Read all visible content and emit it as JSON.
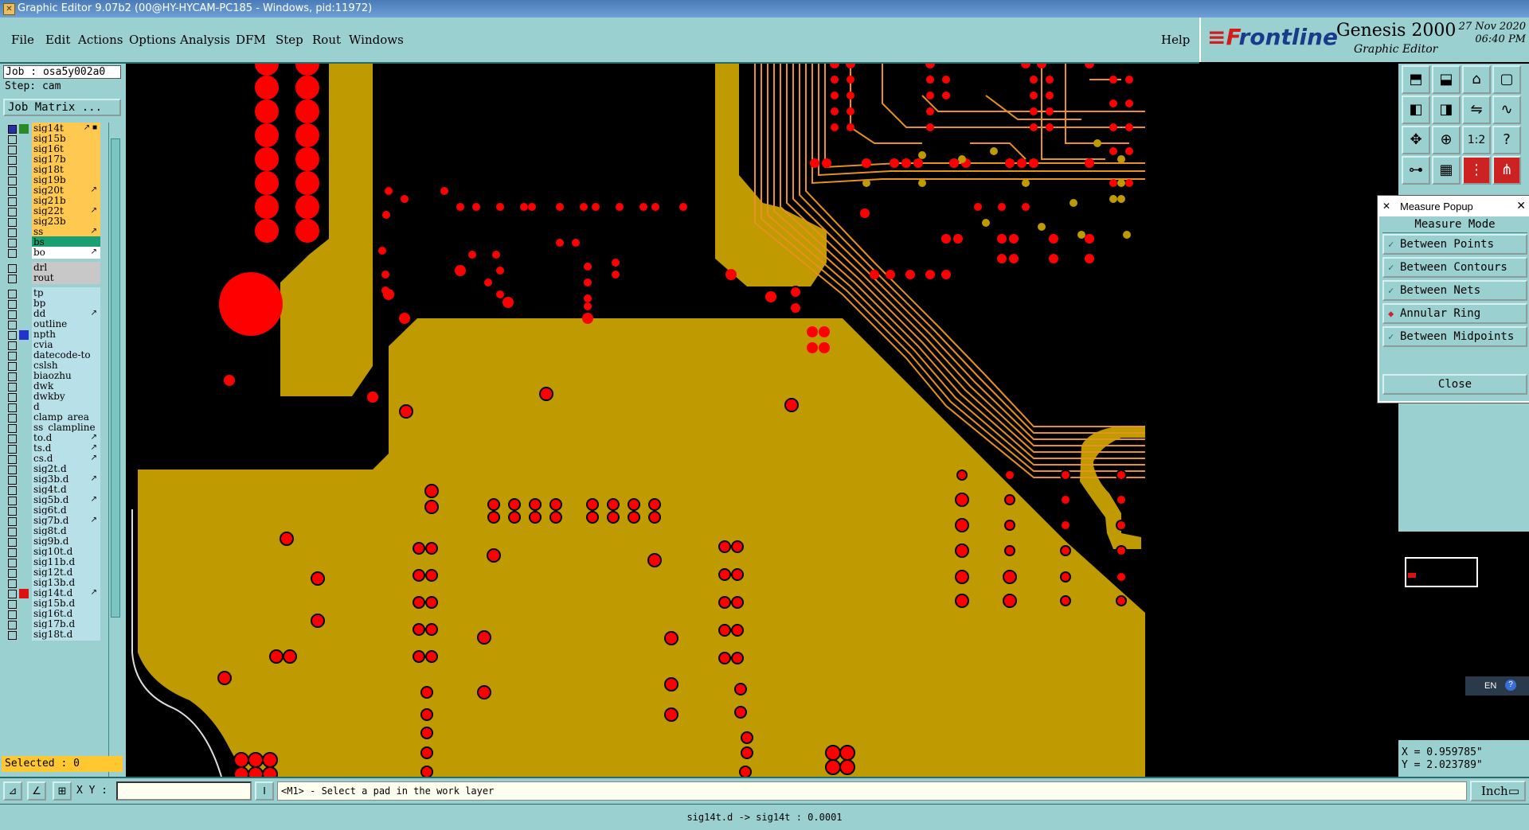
{
  "window": {
    "title": "Graphic Editor 9.07b2 (00@HY-HYCAM-PC185 - Windows, pid:11972)"
  },
  "menu": {
    "file": "File",
    "edit": "Edit",
    "actions": "Actions",
    "options": "Options",
    "analysis": "Analysis",
    "dfm": "DFM",
    "step": "Step",
    "rout": "Rout",
    "windows": "Windows",
    "help": "Help"
  },
  "brand": {
    "logo_f": "F",
    "logo_rest": "rontline",
    "product": "Genesis 2000",
    "subtitle": "Graphic Editor",
    "date": "27 Nov 2020",
    "time": "06:40 PM"
  },
  "job": {
    "job_line": "Job : osa5y002a0",
    "step_line": "Step: cam",
    "matrix_button": "Job Matrix ..."
  },
  "layers": [
    {
      "name": "sig14t",
      "bg": "#ffc850",
      "sw": "#2a8a2a",
      "mk": "↗ ■",
      "checked": true
    },
    {
      "name": "sig15b",
      "bg": "#ffc850",
      "sw": "",
      "mk": ""
    },
    {
      "name": "sig16t",
      "bg": "#ffc850",
      "sw": "",
      "mk": ""
    },
    {
      "name": "sig17b",
      "bg": "#ffc850",
      "sw": "",
      "mk": ""
    },
    {
      "name": "sig18t",
      "bg": "#ffc850",
      "sw": "",
      "mk": ""
    },
    {
      "name": "sig19b",
      "bg": "#ffc850",
      "sw": "",
      "mk": ""
    },
    {
      "name": "sig20t",
      "bg": "#ffc850",
      "sw": "",
      "mk": "↗"
    },
    {
      "name": "sig21b",
      "bg": "#ffc850",
      "sw": "",
      "mk": ""
    },
    {
      "name": "sig22t",
      "bg": "#ffc850",
      "sw": "",
      "mk": "↗"
    },
    {
      "name": "sig23b",
      "bg": "#ffc850",
      "sw": "",
      "mk": ""
    },
    {
      "name": "ss",
      "bg": "#ffc850",
      "sw": "",
      "mk": "↗"
    },
    {
      "name": "bs",
      "bg": "#1aa070",
      "sw": "",
      "mk": ""
    },
    {
      "name": "bo",
      "bg": "#ffffff",
      "sw": "",
      "mk": "↗"
    },
    {
      "name": "drl",
      "bg": "#c8c8c8",
      "sw": "",
      "mk": ""
    },
    {
      "name": "rout",
      "bg": "#c8c8c8",
      "sw": "",
      "mk": ""
    },
    {
      "name": "tp",
      "bg": "#b8e0e8",
      "sw": "",
      "mk": ""
    },
    {
      "name": "bp",
      "bg": "#b8e0e8",
      "sw": "",
      "mk": ""
    },
    {
      "name": "dd",
      "bg": "#b8e0e8",
      "sw": "",
      "mk": "↗"
    },
    {
      "name": "outline",
      "bg": "#b8e0e8",
      "sw": "",
      "mk": ""
    },
    {
      "name": "npth",
      "bg": "#b8e0e8",
      "sw": "#2233cc",
      "mk": ""
    },
    {
      "name": "cvia",
      "bg": "#b8e0e8",
      "sw": "",
      "mk": ""
    },
    {
      "name": "datecode-to",
      "bg": "#b8e0e8",
      "sw": "",
      "mk": ""
    },
    {
      "name": "cslsh",
      "bg": "#b8e0e8",
      "sw": "",
      "mk": ""
    },
    {
      "name": "biaozhu",
      "bg": "#b8e0e8",
      "sw": "",
      "mk": ""
    },
    {
      "name": "dwk",
      "bg": "#b8e0e8",
      "sw": "",
      "mk": ""
    },
    {
      "name": "dwkby",
      "bg": "#b8e0e8",
      "sw": "",
      "mk": ""
    },
    {
      "name": "d",
      "bg": "#b8e0e8",
      "sw": "",
      "mk": ""
    },
    {
      "name": "clamp_area",
      "bg": "#b8e0e8",
      "sw": "",
      "mk": ""
    },
    {
      "name": "ss_clampline",
      "bg": "#b8e0e8",
      "sw": "",
      "mk": ""
    },
    {
      "name": "to.d",
      "bg": "#b8e0e8",
      "sw": "",
      "mk": "↗"
    },
    {
      "name": "ts.d",
      "bg": "#b8e0e8",
      "sw": "",
      "mk": "↗"
    },
    {
      "name": "cs.d",
      "bg": "#b8e0e8",
      "sw": "",
      "mk": "↗"
    },
    {
      "name": "sig2t.d",
      "bg": "#b8e0e8",
      "sw": "",
      "mk": ""
    },
    {
      "name": "sig3b.d",
      "bg": "#b8e0e8",
      "sw": "",
      "mk": "↗"
    },
    {
      "name": "sig4t.d",
      "bg": "#b8e0e8",
      "sw": "",
      "mk": ""
    },
    {
      "name": "sig5b.d",
      "bg": "#b8e0e8",
      "sw": "",
      "mk": "↗"
    },
    {
      "name": "sig6t.d",
      "bg": "#b8e0e8",
      "sw": "",
      "mk": ""
    },
    {
      "name": "sig7b.d",
      "bg": "#b8e0e8",
      "sw": "",
      "mk": "↗"
    },
    {
      "name": "sig8t.d",
      "bg": "#b8e0e8",
      "sw": "",
      "mk": ""
    },
    {
      "name": "sig9b.d",
      "bg": "#b8e0e8",
      "sw": "",
      "mk": ""
    },
    {
      "name": "sig10t.d",
      "bg": "#b8e0e8",
      "sw": "",
      "mk": ""
    },
    {
      "name": "sig11b.d",
      "bg": "#b8e0e8",
      "sw": "",
      "mk": ""
    },
    {
      "name": "sig12t.d",
      "bg": "#b8e0e8",
      "sw": "",
      "mk": ""
    },
    {
      "name": "sig13b.d",
      "bg": "#b8e0e8",
      "sw": "",
      "mk": ""
    },
    {
      "name": "sig14t.d",
      "bg": "#b8e0e8",
      "sw": "#dd1111",
      "mk": "↗"
    },
    {
      "name": "sig15b.d",
      "bg": "#b8e0e8",
      "sw": "",
      "mk": ""
    },
    {
      "name": "sig16t.d",
      "bg": "#b8e0e8",
      "sw": "",
      "mk": ""
    },
    {
      "name": "sig17b.d",
      "bg": "#b8e0e8",
      "sw": "",
      "mk": ""
    },
    {
      "name": "sig18t.d",
      "bg": "#b8e0e8",
      "sw": "",
      "mk": ""
    }
  ],
  "selected": "Selected : 0",
  "measure": {
    "title": "Measure Popup",
    "mode_label": "Measure Mode",
    "options": [
      "Between Points",
      "Between Contours",
      "Between Nets",
      "Annular Ring",
      "Between Midpoints"
    ],
    "active_index": 3,
    "close_label": "Close"
  },
  "coords": {
    "x": "X = 0.959785\"",
    "y": "Y = 2.023789\""
  },
  "bottom": {
    "xy_label": "X Y :",
    "xy_value": "",
    "message": "<M1> - Select a pad in the work layer",
    "unit": "Inch"
  },
  "status": "sig14t.d -> sig14t : 0.0001",
  "lang": "EN",
  "colors": {
    "copper": "#bf9a00",
    "pad": "#ff0000",
    "panel": "#9ad0d0",
    "trace": "#e89020"
  }
}
